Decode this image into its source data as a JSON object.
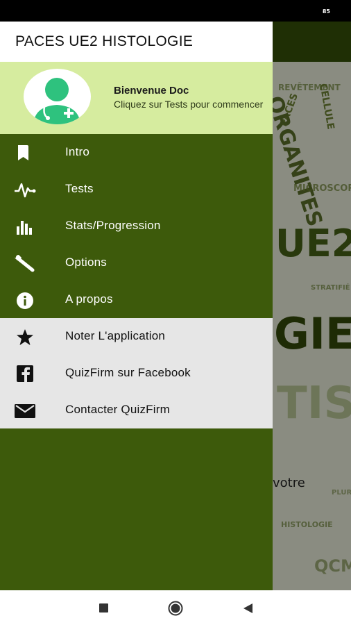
{
  "status_bar": {
    "battery": "85"
  },
  "background": {
    "poster_words": [
      "PACES",
      "CELLULE",
      "REVÊTEMENT",
      "ORGANITES",
      "MICROSCOPIE",
      "UE2",
      "STRATIFIÉ",
      "GIE",
      "TISSU",
      "HISTOLOGIE",
      "QCM",
      "PLURI"
    ],
    "body_text": "votre"
  },
  "drawer": {
    "title": "PACES UE2 HISTOLOGIE",
    "header": {
      "name": "Bienvenue Doc",
      "subtitle": "Cliquez sur Tests pour commencer"
    },
    "items": [
      {
        "label": "Intro",
        "icon": "bookmark-icon"
      },
      {
        "label": "Tests",
        "icon": "pulse-icon"
      },
      {
        "label": "Stats/Progression",
        "icon": "bar-chart-icon"
      },
      {
        "label": "Options",
        "icon": "wrench-icon"
      },
      {
        "label": "A propos",
        "icon": "info-icon"
      }
    ],
    "secondary_items": [
      {
        "label": "Noter L'application",
        "icon": "star-icon"
      },
      {
        "label": "QuizFirm sur Facebook",
        "icon": "facebook-icon"
      },
      {
        "label": "Contacter QuizFirm",
        "icon": "mail-icon"
      }
    ]
  },
  "nav": {
    "buttons": [
      "recents",
      "home",
      "back"
    ]
  },
  "colors": {
    "drawer_bg": "#3d5a0b",
    "header_bg": "#d6ec9f",
    "secondary_bg": "#e6e6e6"
  }
}
